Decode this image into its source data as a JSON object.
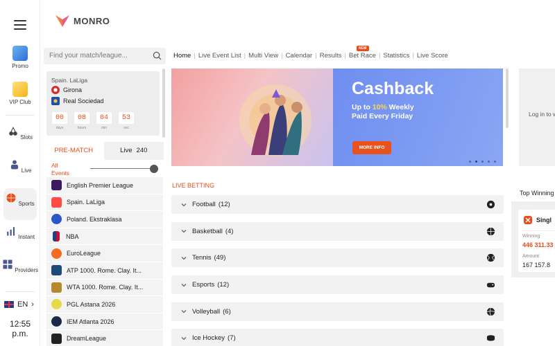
{
  "brand": {
    "name": "MONRO"
  },
  "rail": {
    "items": [
      {
        "label": "Promo",
        "icon": "promo-icon"
      },
      {
        "label": "VIP Club",
        "icon": "crown-icon"
      },
      {
        "label": "Slots",
        "icon": "cherry-icon"
      },
      {
        "label": "Live",
        "icon": "dealer-icon"
      },
      {
        "label": "Sports",
        "icon": "ball-icon"
      },
      {
        "label": "Instant",
        "icon": "bars-icon"
      },
      {
        "label": "Providers",
        "icon": "grid-icon"
      }
    ],
    "language": "EN",
    "time": "12:55",
    "ampm": "p.m."
  },
  "search": {
    "placeholder": "Find your match/league..."
  },
  "nav": {
    "items": [
      "Home",
      "Live Event List",
      "Multi View",
      "Calendar",
      "Results",
      "Bet Race",
      "Statistics",
      "Live Score"
    ],
    "new_badge": "NEW"
  },
  "match": {
    "league": "Spain. LaLiga",
    "home": "Girona",
    "away": "Real Sociedad",
    "countdown": [
      {
        "value": "00",
        "label": "days"
      },
      {
        "value": "08",
        "label": "hours"
      },
      {
        "value": "04",
        "label": "min"
      },
      {
        "value": "53",
        "label": "sec"
      }
    ]
  },
  "tabs": {
    "prematch": "PRE-MATCH",
    "live": "Live",
    "live_count": "240"
  },
  "filter": {
    "all_events_1": "All",
    "all_events_2": "Events"
  },
  "leagues": [
    "English Premier League",
    "Spain. LaLiga",
    "Poland. Ekstraklasa",
    "NBA",
    "EuroLeague",
    "ATP 1000. Rome. Clay. It...",
    "WTA 1000. Rome. Clay. It...",
    "PGL Astana 2026",
    "IEM Atlanta 2026",
    "DreamLeague"
  ],
  "banner": {
    "title": "Cashback",
    "line1_prefix": "Up to ",
    "line1_pct": "10%",
    "line1_suffix": " Weekly",
    "line2": "Paid Every Friday",
    "button": "MORE INFO"
  },
  "live_betting": {
    "title": "LIVE BETTING",
    "sports": [
      {
        "name": "Football",
        "count": "(12)",
        "icon": "football-icon"
      },
      {
        "name": "Basketball",
        "count": "(4)",
        "icon": "basketball-icon"
      },
      {
        "name": "Tennis",
        "count": "(49)",
        "icon": "tennis-icon"
      },
      {
        "name": "Esports",
        "count": "(12)",
        "icon": "gamepad-icon"
      },
      {
        "name": "Volleyball",
        "count": "(6)",
        "icon": "volleyball-icon"
      },
      {
        "name": "Ice Hockey",
        "count": "(7)",
        "icon": "puck-icon"
      }
    ]
  },
  "right": {
    "login_text": "Log in to w",
    "top_winning": "Top Winning",
    "card": {
      "name": "Singl",
      "winning_label": "Winning",
      "winning_value": "446 311.33",
      "amount_label": "Amount",
      "amount_value": "167 157.8"
    }
  },
  "colors": {
    "accent": "#e84e1b",
    "banner_blue": "#7f97ee"
  }
}
